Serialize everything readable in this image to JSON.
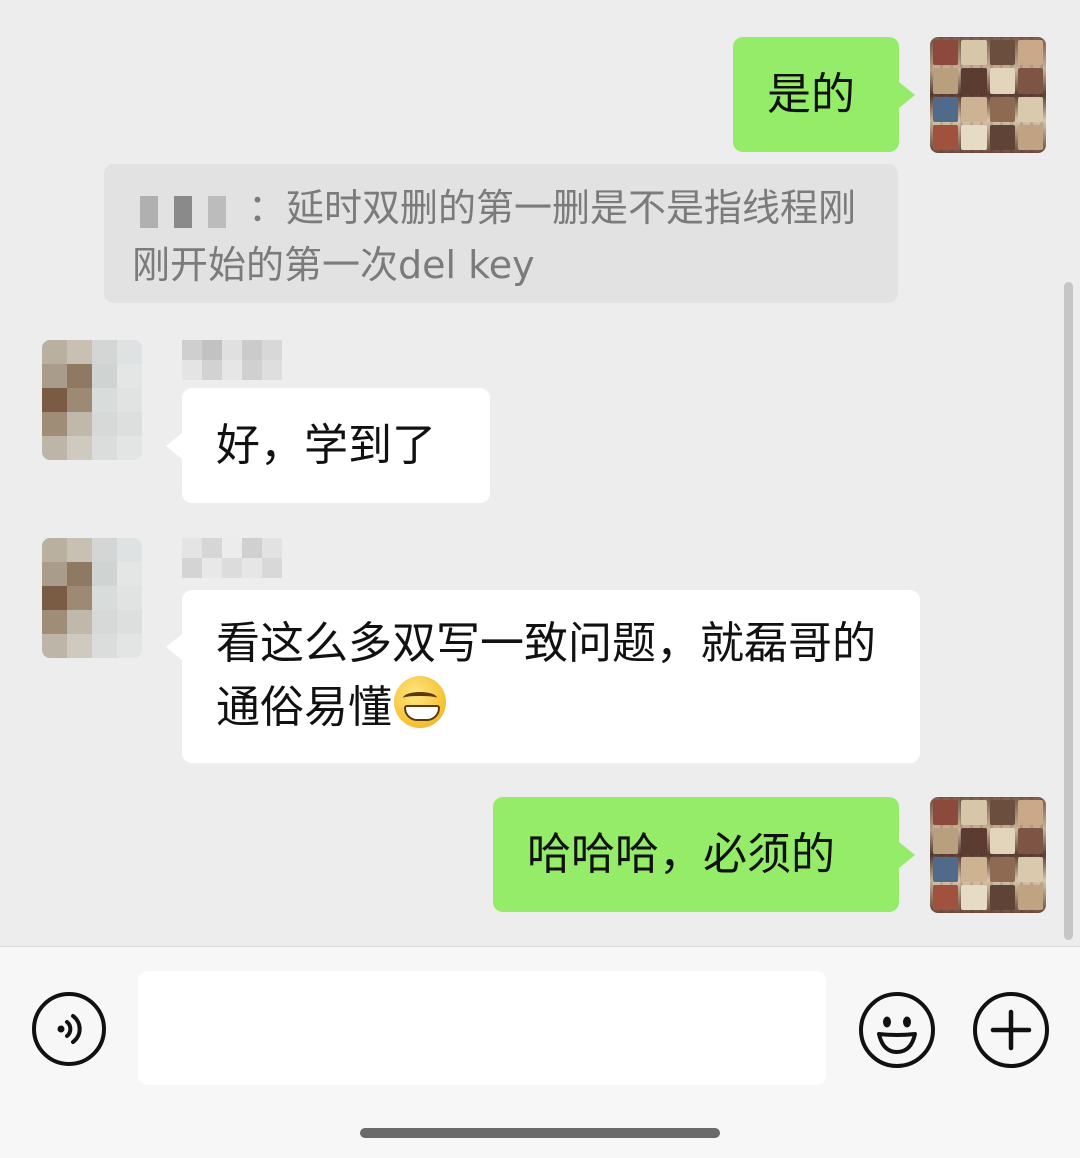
{
  "messages": [
    {
      "sender": "me",
      "text": "是的"
    },
    {
      "sender": "quote",
      "text": "：延时双删的第一删是不是指线程刚刚开始的第一次del key"
    },
    {
      "sender": "other",
      "text": "好，学到了"
    },
    {
      "sender": "other",
      "text": "看这么多双写一致问题，就磊哥的通俗易懂"
    },
    {
      "sender": "me",
      "text": "哈哈哈，必须的"
    }
  ],
  "input": {
    "value": "",
    "placeholder": ""
  },
  "icons": {
    "voice": "voice-icon",
    "emoji": "smiley-icon",
    "more": "plus-icon"
  },
  "colors": {
    "chat_background": "#ededed",
    "my_bubble": "#95ec69",
    "other_bubble": "#ffffff",
    "quote_background": "#e2e2e2",
    "input_bar": "#f7f7f7"
  }
}
